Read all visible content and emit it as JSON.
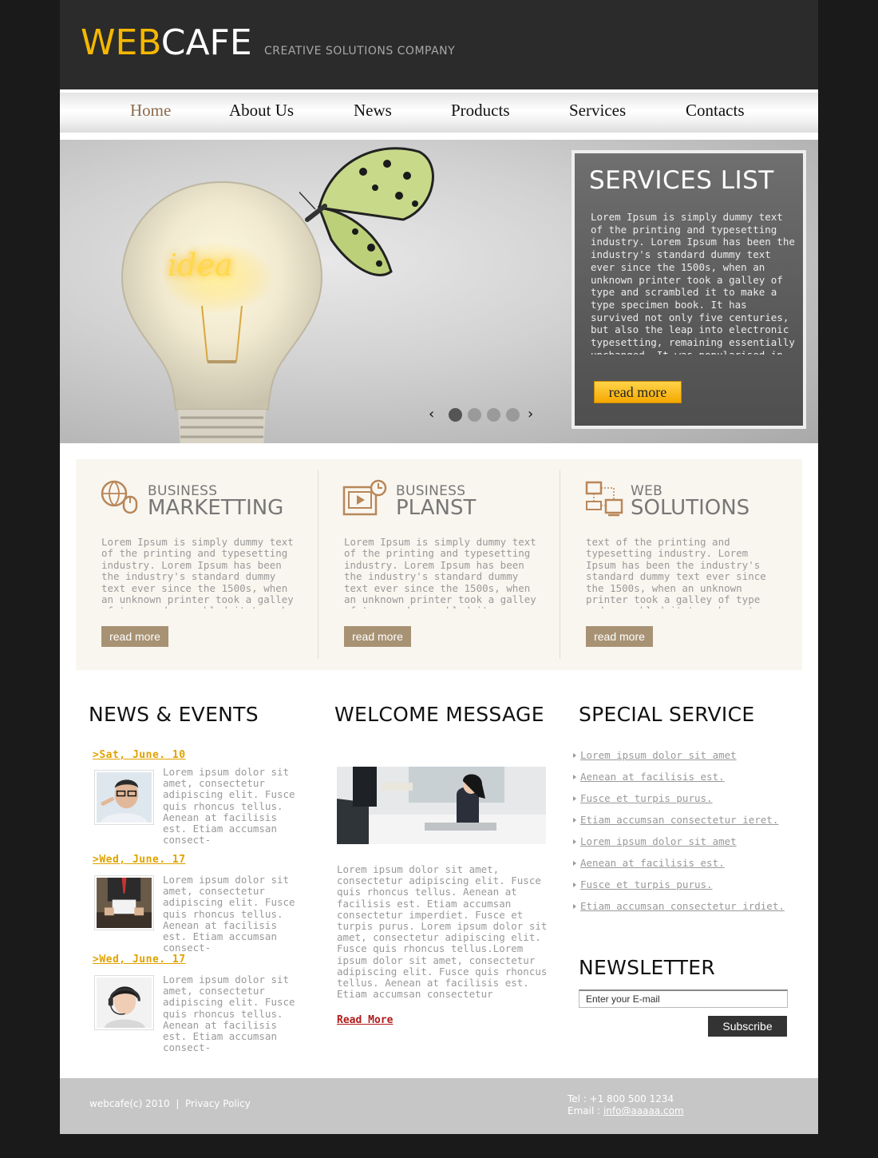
{
  "header": {
    "logo_part1": "WEB",
    "logo_part2": "CAFE",
    "tagline": "CREATIVE SOLUTIONS COMPANY"
  },
  "nav": {
    "items": [
      "Home",
      "About Us",
      "News",
      "Products",
      "Services",
      "Contacts"
    ],
    "active": "Home"
  },
  "hero": {
    "title": "SERVICES LIST",
    "text": "Lorem Ipsum is simply dummy text of the printing and typesetting industry. Lorem Ipsum has been the industry's standard dummy text ever since the 1500s, when an unknown printer took a galley of type and scrambled it to make a type specimen book. It has survived not only five centuries, but also the leap into electronic typesetting, remaining essentially unchanged. It was popularised in the",
    "button": "read more",
    "bulb_text": "idea",
    "slider": {
      "prev": "‹",
      "next": "›",
      "dots": 4,
      "active_dot": 1
    }
  },
  "features": [
    {
      "small": "BUSINESS",
      "big": "MARKETTING",
      "icon": "globe-mouse-icon",
      "text": "Lorem Ipsum is simply dummy text of the printing and typesetting industry. Lorem Ipsum has been the industry's standard dummy text ever since the 1500s, when an unknown printer took a galley of type and scrambled it to make a type specimen book. It has",
      "button": "read more"
    },
    {
      "small": "BUSINESS",
      "big": "PLANST",
      "icon": "video-player-icon",
      "text": "Lorem Ipsum is simply dummy text of the printing and typesetting industry. Lorem Ipsum has been the industry's standard dummy text ever since the 1500s, when an unknown printer took a galley of type and scrambled it",
      "button": "read more"
    },
    {
      "small": "WEB",
      "big": "SOLUTIONS",
      "icon": "network-computers-icon",
      "text": "text of the printing and typesetting industry. Lorem Ipsum has been the industry's standard dummy text ever since the 1500s, when an unknown printer took a galley of type and scrambled it to make a type specimen",
      "button": "read more"
    }
  ],
  "news": {
    "title": "NEWS & EVENTS",
    "items": [
      {
        "date": ">Sat, June. 10",
        "text": "Lorem ipsum dolor sit amet, consectetur adipiscing elit. Fusce quis rhoncus tellus. Aenean at facilisis est. Etiam accumsan consect-"
      },
      {
        "date": ">Wed, June. 17",
        "text": "Lorem ipsum dolor sit amet, consectetur adipiscing elit. Fusce quis rhoncus tellus. Aenean at facilisis est. Etiam accumsan consect-"
      },
      {
        "date": ">Wed, June. 17",
        "text": "Lorem ipsum dolor sit amet, consectetur adipiscing elit. Fusce quis rhoncus tellus. Aenean at facilisis est. Etiam accumsan consect-"
      }
    ]
  },
  "welcome": {
    "title": "WELCOME MESSAGE",
    "text": "Lorem ipsum dolor sit amet, consectetur adipiscing elit. Fusce quis rhoncus tellus. Aenean at facilisis est. Etiam accumsan consectetur imperdiet. Fusce et turpis purus. Lorem ipsum dolor sit amet, consectetur adipiscing elit. Fusce quis rhoncus tellus.Lorem ipsum dolor sit amet, consectetur adipiscing elit. Fusce quis rhoncus tellus. Aenean at facilisis est. Etiam accumsan consectetur",
    "read_more": "Read More"
  },
  "special": {
    "title": "SPECIAL SERVICE",
    "items": [
      "Lorem ipsum dolor sit amet",
      "Aenean at facilisis est.",
      "Fusce et turpis purus.",
      "Etiam accumsan consectetur ieret.",
      "Lorem ipsum dolor sit amet",
      "Aenean at facilisis est.",
      "Fusce et turpis purus.",
      "Etiam accumsan consectetur irdiet."
    ]
  },
  "newsletter": {
    "title": "NEWSLETTER",
    "placeholder": "Enter your E-mail",
    "button": "Subscribe"
  },
  "footer": {
    "copyright": "webcafe(c) 2010",
    "separator": "|",
    "privacy": "Privacy Policy",
    "tel": "Tel : +1 800 500 1234",
    "email_label": "Email : ",
    "email": "info@aaaaa.com"
  },
  "colors": {
    "accent": "#f5b800",
    "nav_active": "#8a6a4a",
    "feature_button": "#a89274",
    "date": "#e0a200",
    "read_more": "#b01a1a"
  }
}
